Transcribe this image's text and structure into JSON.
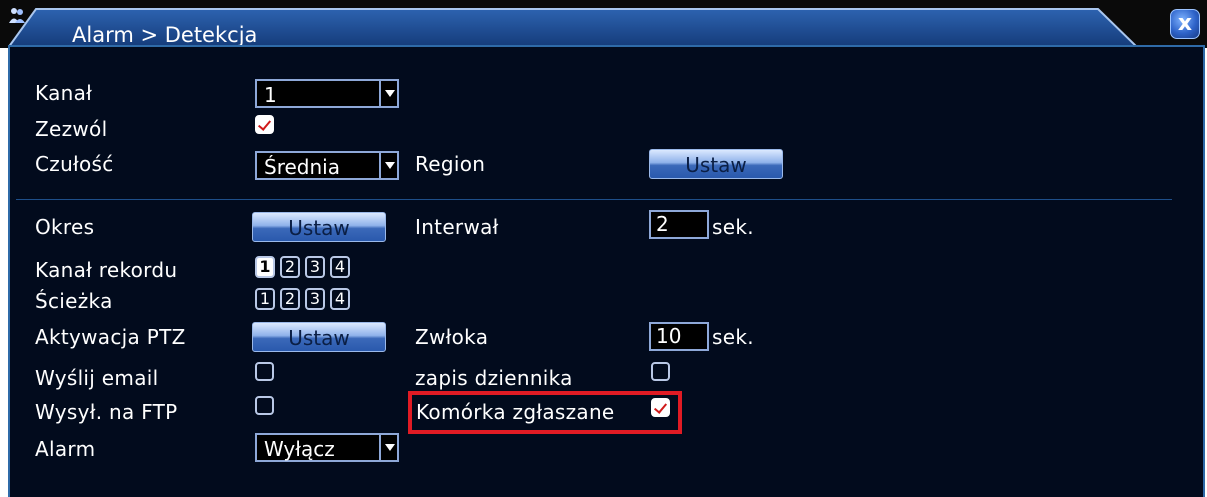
{
  "window": {
    "title": "Alarm > Detekcja",
    "close_label": "x"
  },
  "form": {
    "kanal_label": "Kanał",
    "kanal_value": "1",
    "zezwol_label": "Zezwól",
    "zezwol_checked": true,
    "czulosc_label": "Czułość",
    "czulosc_value": "Średnia",
    "region_label": "Region",
    "region_button": "Ustaw",
    "okres_label": "Okres",
    "okres_button": "Ustaw",
    "interwal_label": "Interwał",
    "interwal_value": "2",
    "interwal_unit": "sek.",
    "kanal_rekordu_label": "Kanał rekordu",
    "kanal_rekordu_channels": [
      "1",
      "2",
      "3",
      "4"
    ],
    "kanal_rekordu_selected": [
      true,
      false,
      false,
      false
    ],
    "sciezka_label": "Ścieżka",
    "sciezka_channels": [
      "1",
      "2",
      "3",
      "4"
    ],
    "sciezka_selected": [
      false,
      false,
      false,
      false
    ],
    "ptz_label": "Aktywacja PTZ",
    "ptz_button": "Ustaw",
    "zwloka_label": "Zwłoka",
    "zwloka_value": "10",
    "zwloka_unit": "sek.",
    "email_label": "Wyślij email",
    "email_checked": false,
    "dziennik_label": "zapis dziennika",
    "dziennik_checked": false,
    "ftp_label": "Wysył. na FTP",
    "ftp_checked": false,
    "komorka_label": "Komórka zgłaszane",
    "komorka_checked": true,
    "alarm_label": "Alarm",
    "alarm_value": "Wyłącz"
  },
  "colors": {
    "background": "#020b1d",
    "border": "#2f6ba8",
    "highlight": "#e01b24"
  }
}
